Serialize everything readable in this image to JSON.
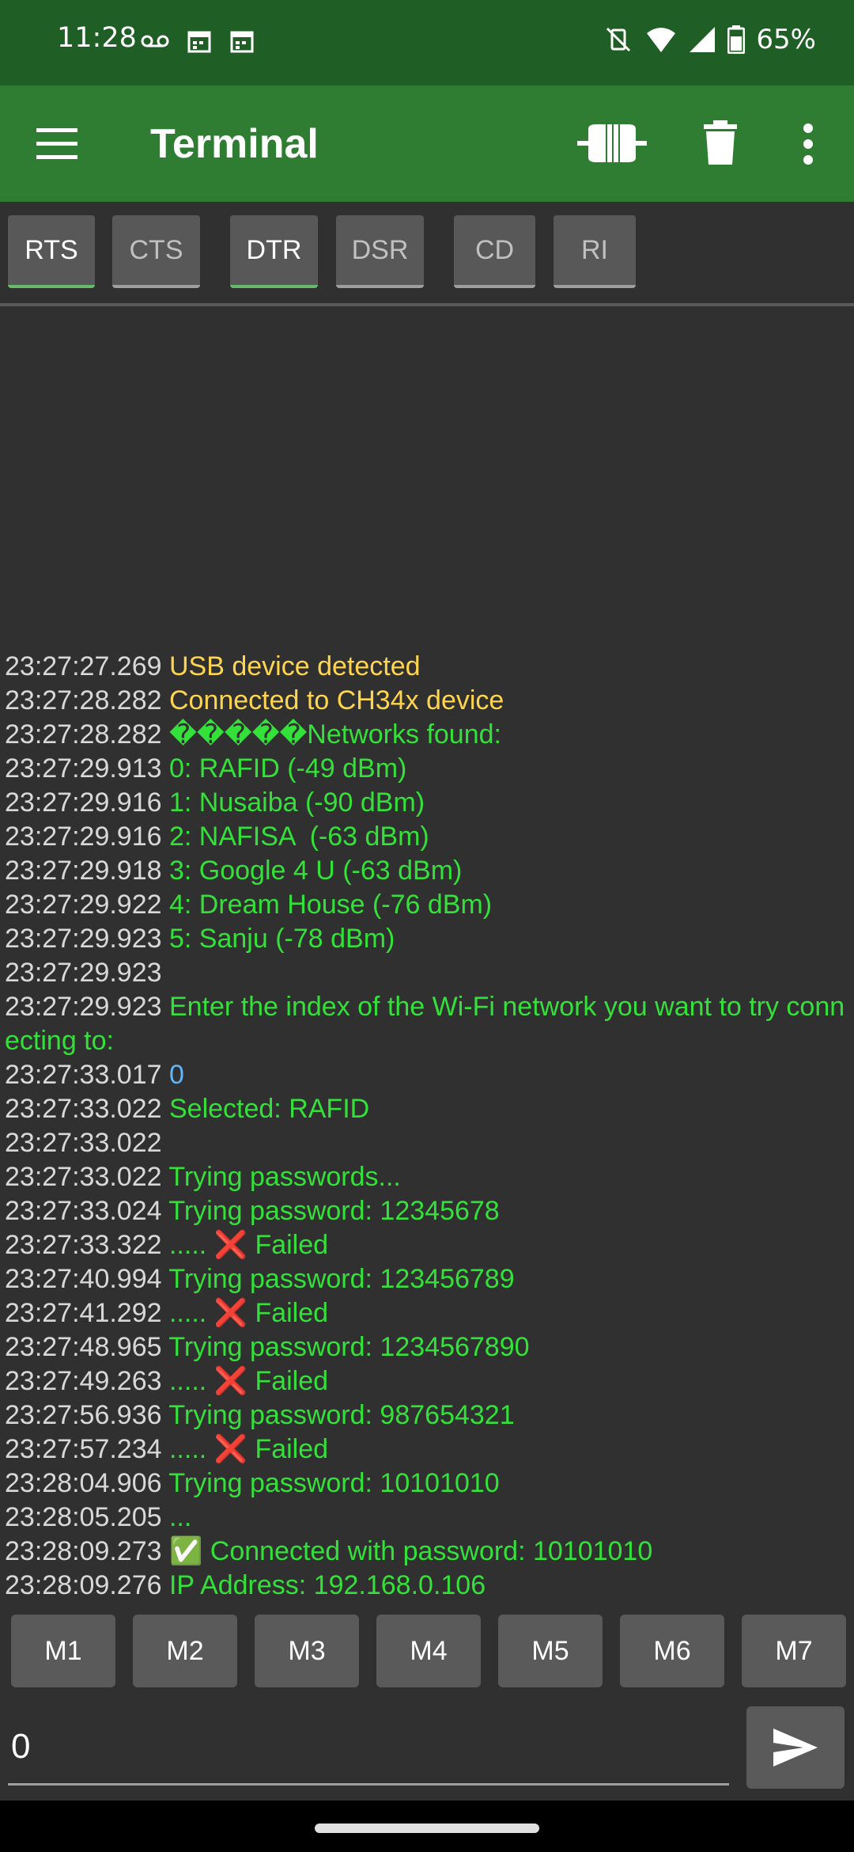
{
  "status_bar": {
    "time": "11:28",
    "battery": "65%"
  },
  "app_bar": {
    "title": "Terminal"
  },
  "signals": [
    {
      "label": "RTS",
      "on": true
    },
    {
      "label": "CTS",
      "on": false
    },
    {
      "label": "DTR",
      "on": true
    },
    {
      "label": "DSR",
      "on": false
    },
    {
      "label": "CD",
      "on": false
    },
    {
      "label": "RI",
      "on": false
    }
  ],
  "log": [
    {
      "ts": "23:27:27.269",
      "msg": "USB device detected",
      "color": "yellow"
    },
    {
      "ts": "23:27:28.282",
      "msg": "Connected to CH34x device",
      "color": "yellow"
    },
    {
      "ts": "23:27:28.282",
      "msg": "�����Networks found:",
      "color": "green"
    },
    {
      "ts": "23:27:29.913",
      "msg": "0: RAFID (-49 dBm)",
      "color": "green"
    },
    {
      "ts": "23:27:29.916",
      "msg": "1: Nusaiba (-90 dBm)",
      "color": "green"
    },
    {
      "ts": "23:27:29.916",
      "msg": "2: NAFISA  (-63 dBm)",
      "color": "green"
    },
    {
      "ts": "23:27:29.918",
      "msg": "3: Google 4 U (-63 dBm)",
      "color": "green"
    },
    {
      "ts": "23:27:29.922",
      "msg": "4: Dream House (-76 dBm)",
      "color": "green"
    },
    {
      "ts": "23:27:29.923",
      "msg": "5: Sanju (-78 dBm)",
      "color": "green"
    },
    {
      "ts": "23:27:29.923",
      "msg": "",
      "color": "green"
    },
    {
      "ts": "23:27:29.923",
      "msg": "Enter the index of the Wi-Fi network you want to try connecting to:",
      "color": "green"
    },
    {
      "ts": "23:27:33.017",
      "msg": "0",
      "color": "blue"
    },
    {
      "ts": "23:27:33.022",
      "msg": "Selected: RAFID",
      "color": "green"
    },
    {
      "ts": "23:27:33.022",
      "msg": "",
      "color": "green"
    },
    {
      "ts": "23:27:33.022",
      "msg": "Trying passwords...",
      "color": "green"
    },
    {
      "ts": "23:27:33.024",
      "msg": "Trying password: 12345678",
      "color": "green"
    },
    {
      "ts": "23:27:33.322",
      "msg": "..... ❌ Failed",
      "color": "green"
    },
    {
      "ts": "23:27:40.994",
      "msg": "Trying password: 123456789",
      "color": "green"
    },
    {
      "ts": "23:27:41.292",
      "msg": "..... ❌ Failed",
      "color": "green"
    },
    {
      "ts": "23:27:48.965",
      "msg": "Trying password: 1234567890",
      "color": "green"
    },
    {
      "ts": "23:27:49.263",
      "msg": "..... ❌ Failed",
      "color": "green"
    },
    {
      "ts": "23:27:56.936",
      "msg": "Trying password: 987654321",
      "color": "green"
    },
    {
      "ts": "23:27:57.234",
      "msg": "..... ❌ Failed",
      "color": "green"
    },
    {
      "ts": "23:28:04.906",
      "msg": "Trying password: 10101010",
      "color": "green"
    },
    {
      "ts": "23:28:05.205",
      "msg": "...",
      "color": "green"
    },
    {
      "ts": "23:28:09.273",
      "msg": "✅ Connected with password: 10101010",
      "color": "green"
    },
    {
      "ts": "23:28:09.276",
      "msg": "IP Address: 192.168.0.106",
      "color": "green"
    }
  ],
  "macros": [
    "M1",
    "M2",
    "M3",
    "M4",
    "M5",
    "M6",
    "M7"
  ],
  "send": {
    "value": "0"
  },
  "colors": {
    "appbar": "#2e7d32",
    "statusbar": "#1f5e25",
    "log_yellow": "#ffd54f",
    "log_green": "#34e03a",
    "log_blue": "#64b5f6"
  },
  "icons": [
    "menu-icon",
    "usb-connect-icon",
    "trash-icon",
    "more-vert-icon",
    "send-icon"
  ]
}
